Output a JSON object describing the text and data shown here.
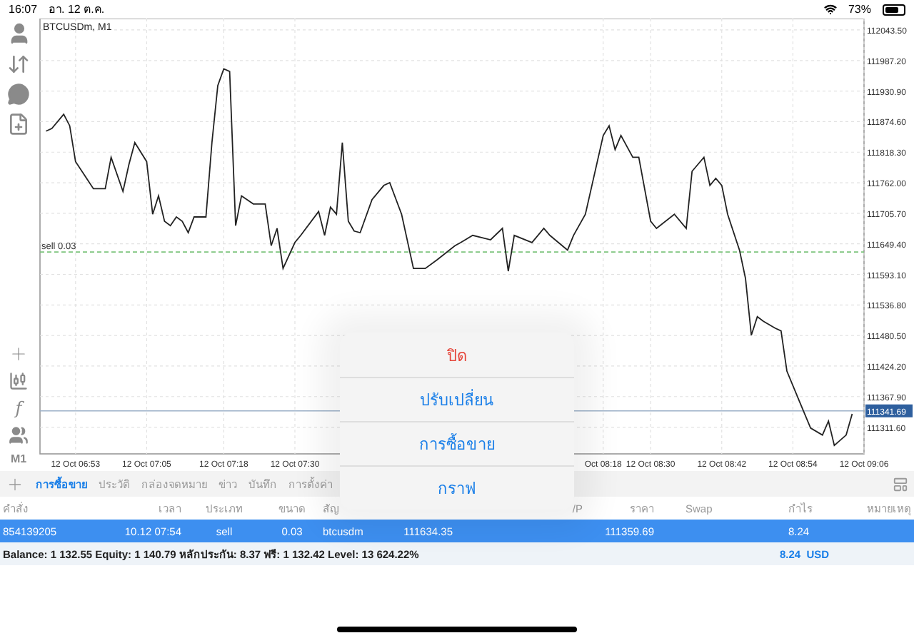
{
  "status_bar": {
    "time": "16:07",
    "date": "อา. 12 ต.ค.",
    "battery": "73%"
  },
  "toolbar": {
    "mode_label": "f",
    "timeframe": "M1"
  },
  "chart": {
    "title": "BTCUSDm, M1",
    "current_price_label": "111341.69",
    "chart_data": {
      "type": "line",
      "grid": true,
      "ref_lines": [
        {
          "axis": "y",
          "value": 111634.35,
          "color": "#7cc47c",
          "label": "sell 0.03"
        },
        {
          "axis": "y",
          "value": 111341.69,
          "color": "#9bb0c8"
        }
      ],
      "series": [
        {
          "color": "#222222",
          "values": [
            111857,
            111862,
            null,
            111888,
            111867,
            111801,
            null,
            null,
            111751,
            null,
            111751,
            111809,
            null,
            111746,
            111796,
            111836,
            null,
            111801,
            111704,
            111738,
            111691,
            111683,
            111699,
            111691,
            111670,
            111699,
            null,
            111699,
            111836,
            111941,
            111972,
            111967,
            111683,
            111738,
            null,
            111723,
            null,
            111723,
            111646,
            111678,
            111604,
            null,
            111652,
            111665,
            null,
            null,
            111709,
            111665,
            111717,
            111704,
            111836,
            111691,
            111673,
            111670,
            null,
            111731,
            null,
            111757,
            111762,
            null,
            111704,
            null,
            111604,
            null,
            111604,
            null,
            111620,
            null,
            null,
            111646,
            111652,
            null,
            111665,
            null,
            null,
            111657,
            null,
            111678,
            111599,
            111665,
            null,
            null,
            111652,
            null,
            111678,
            111665,
            null,
            null,
            111638,
            111665,
            null,
            111704,
            null,
            null,
            111849,
            111867,
            111823,
            111849,
            null,
            111809,
            111809,
            null,
            111691,
            111678,
            null,
            null,
            111704,
            null,
            111678,
            111783,
            null,
            111809,
            111757,
            111770,
            111757,
            111704,
            null,
            111638,
            111586,
            111481,
            111515,
            111507,
            null,
            111494,
            111489,
            111415,
            null,
            111362,
            null,
            111310,
            null,
            111297,
            111323,
            111278,
            null,
            111297,
            111336,
            null,
            null
          ]
        }
      ],
      "categories": [
        null,
        null,
        null,
        null,
        null,
        "12 Oct 06:53",
        null,
        null,
        null,
        null,
        null,
        null,
        null,
        null,
        null,
        null,
        null,
        "12 Oct 07:05",
        null,
        null,
        null,
        null,
        null,
        null,
        null,
        null,
        null,
        null,
        null,
        null,
        "12 Oct 07:18",
        null,
        null,
        null,
        null,
        null,
        null,
        null,
        null,
        null,
        null,
        null,
        "12 Oct 07:30",
        null,
        null,
        null,
        null,
        null,
        null,
        null,
        null,
        null,
        null,
        null,
        null,
        null,
        null,
        null,
        null,
        null,
        null,
        null,
        null,
        null,
        null,
        null,
        null,
        null,
        null,
        null,
        null,
        null,
        null,
        null,
        null,
        null,
        null,
        null,
        null,
        null,
        null,
        null,
        null,
        null,
        null,
        null,
        null,
        null,
        null,
        null,
        null,
        null,
        null,
        null,
        "Oct 08:18",
        null,
        null,
        null,
        null,
        null,
        null,
        null,
        "12 Oct 08:30",
        null,
        null,
        null,
        null,
        null,
        null,
        null,
        null,
        null,
        null,
        null,
        "12 Oct 08:42",
        null,
        null,
        null,
        null,
        null,
        null,
        null,
        null,
        null,
        null,
        null,
        "12 Oct 08:54",
        null,
        null,
        null,
        null,
        null,
        null,
        null,
        null,
        null,
        null,
        null,
        "12 Oct 09:06"
      ],
      "ylim": [
        111262.4,
        112064.5
      ],
      "yticks": [
        {
          "value": 112043.5,
          "label": "112043.50"
        },
        {
          "value": 111987.2,
          "label": "111987.20"
        },
        {
          "value": 111930.9,
          "label": "111930.90"
        },
        {
          "value": 111874.6,
          "label": "111874.60"
        },
        {
          "value": 111818.3,
          "label": "111818.30"
        },
        {
          "value": 111762,
          "label": "111762.00"
        },
        {
          "value": 111705.7,
          "label": "111705.70"
        },
        {
          "value": 111649.4,
          "label": "111649.40"
        },
        {
          "value": 111593.1,
          "label": "111593.10"
        },
        {
          "value": 111536.8,
          "label": "111536.80"
        },
        {
          "value": 111480.5,
          "label": "111480.50"
        },
        {
          "value": 111424.2,
          "label": "111424.20"
        },
        {
          "value": 111367.9,
          "label": "111367.90"
        },
        {
          "value": 111311.6,
          "label": "111311.60"
        }
      ]
    }
  },
  "tabs": [
    {
      "label": "การซื้อขาย",
      "selected": true
    },
    {
      "label": "ประวัติ",
      "selected": false
    },
    {
      "label": "กล่องจดหมาย",
      "selected": false
    },
    {
      "label": "ข่าว",
      "selected": false
    },
    {
      "label": "บันทึก",
      "selected": false
    },
    {
      "label": "การตั้งค่า",
      "selected": false
    }
  ],
  "table": {
    "columns": [
      "คำสั่ง",
      "เวลา",
      "ประเภท",
      "ขนาด",
      "สัญ",
      null,
      null,
      "/P",
      "ราคา",
      "Swap",
      "กำไร",
      "หมายเหตุ"
    ],
    "rows": [
      {
        "selected": true,
        "cells": [
          "854139205",
          "10.12 07:54",
          "sell",
          "0.03",
          "btcusdm",
          "111634.35",
          null,
          null,
          "111359.69",
          null,
          "8.24",
          null
        ]
      }
    ],
    "summary": "Balance: 1 132.55 Equity: 1 140.79 หลักประกัน: 8.37 ฟรี: 1 132.42 Level: 13 624.22%",
    "total_profit": "8.24  USD"
  },
  "action_sheet": [
    {
      "label": "ปิด",
      "kind": "destructive"
    },
    {
      "label": "ปรับเปลี่ยน",
      "kind": "default"
    },
    {
      "label": "การซื้อขาย",
      "kind": "default"
    },
    {
      "label": "กราฟ",
      "kind": "default"
    }
  ]
}
